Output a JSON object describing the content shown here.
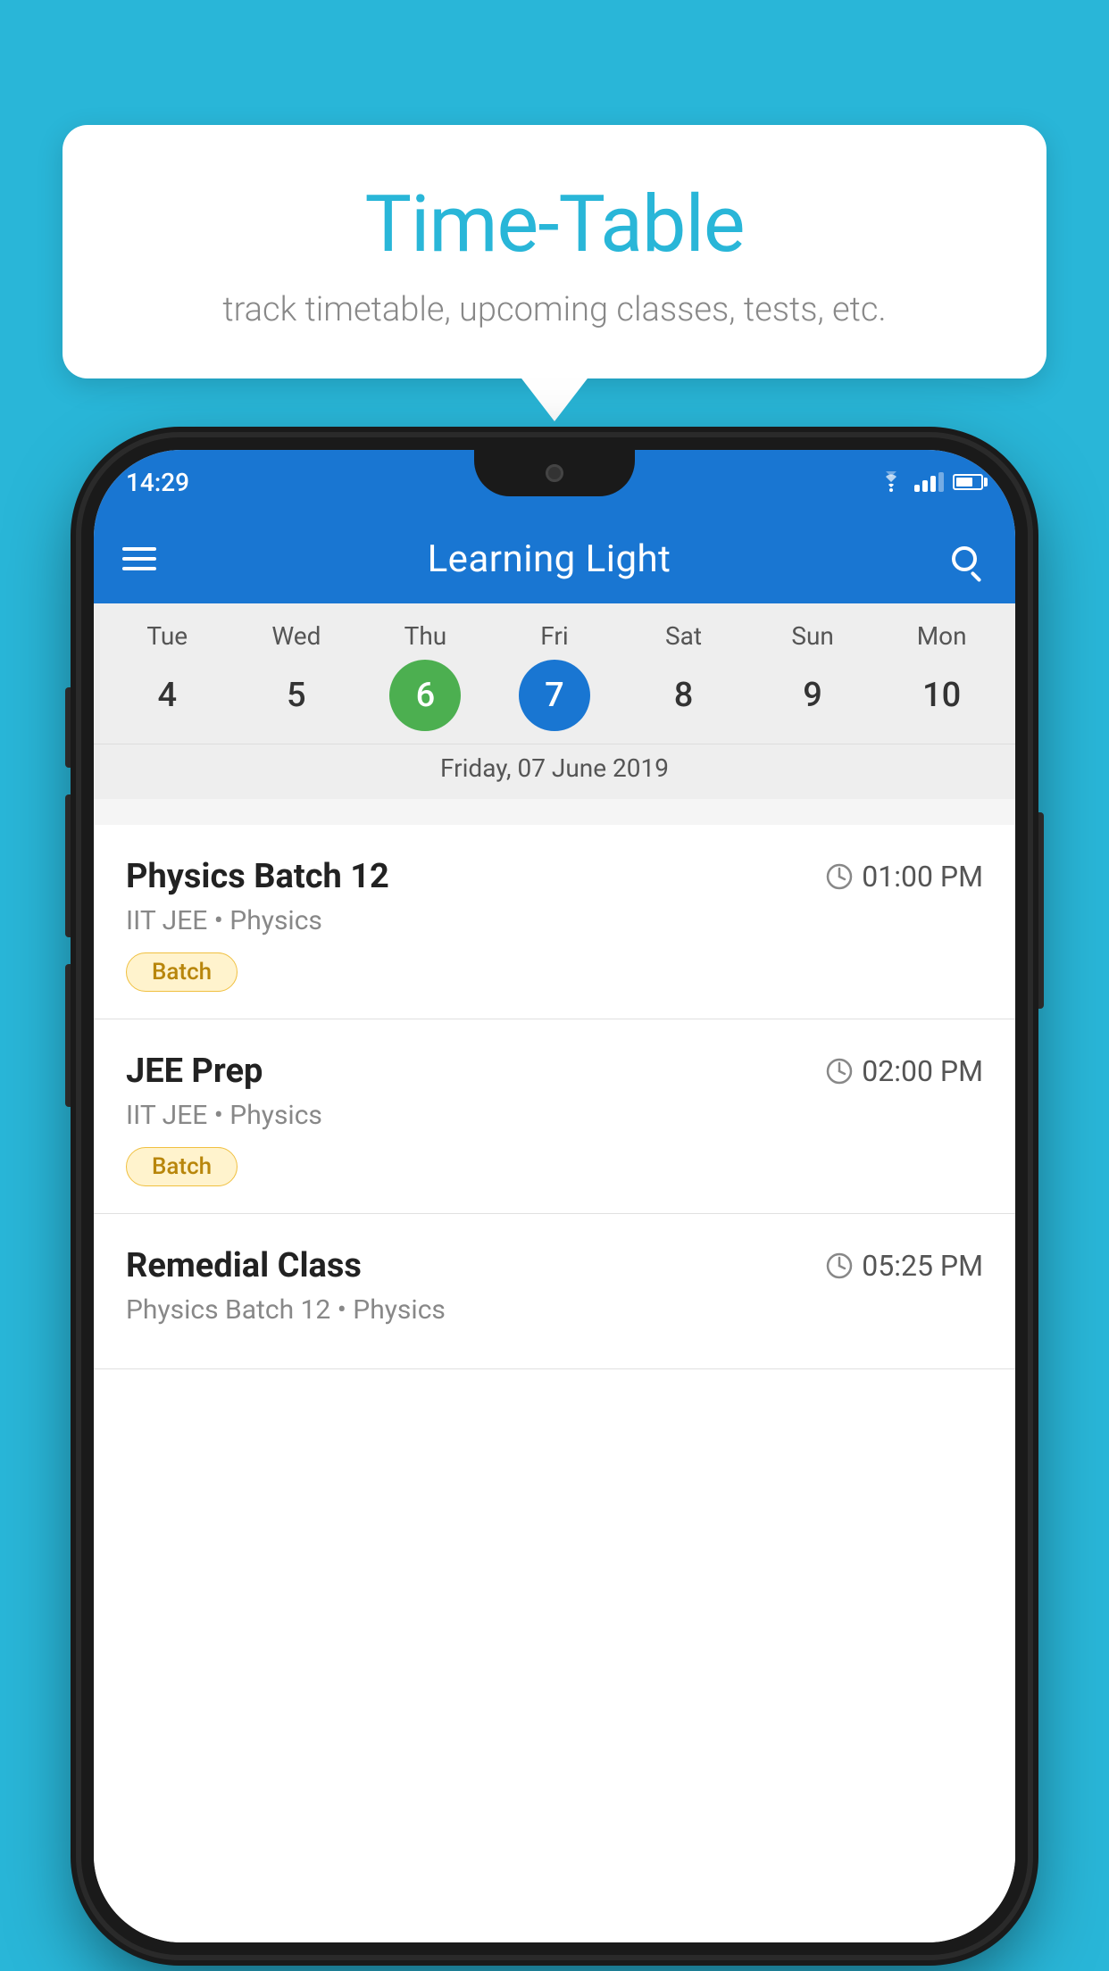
{
  "background_color": "#29B6D8",
  "tooltip": {
    "title": "Time-Table",
    "subtitle": "track timetable, upcoming classes, tests, etc."
  },
  "app": {
    "name": "Learning Light",
    "status_time": "14:29"
  },
  "calendar": {
    "selected_date_label": "Friday, 07 June 2019",
    "days": [
      {
        "label": "Tue",
        "num": "4",
        "state": "normal"
      },
      {
        "label": "Wed",
        "num": "5",
        "state": "normal"
      },
      {
        "label": "Thu",
        "num": "6",
        "state": "today"
      },
      {
        "label": "Fri",
        "num": "7",
        "state": "selected"
      },
      {
        "label": "Sat",
        "num": "8",
        "state": "normal"
      },
      {
        "label": "Sun",
        "num": "9",
        "state": "normal"
      },
      {
        "label": "Mon",
        "num": "10",
        "state": "normal"
      }
    ]
  },
  "classes": [
    {
      "name": "Physics Batch 12",
      "time": "01:00 PM",
      "subtitle": "IIT JEE • Physics",
      "badge": "Batch"
    },
    {
      "name": "JEE Prep",
      "time": "02:00 PM",
      "subtitle": "IIT JEE • Physics",
      "badge": "Batch"
    },
    {
      "name": "Remedial Class",
      "time": "05:25 PM",
      "subtitle": "Physics Batch 12 • Physics",
      "badge": null
    }
  ],
  "icons": {
    "hamburger": "☰",
    "search": "🔍"
  }
}
